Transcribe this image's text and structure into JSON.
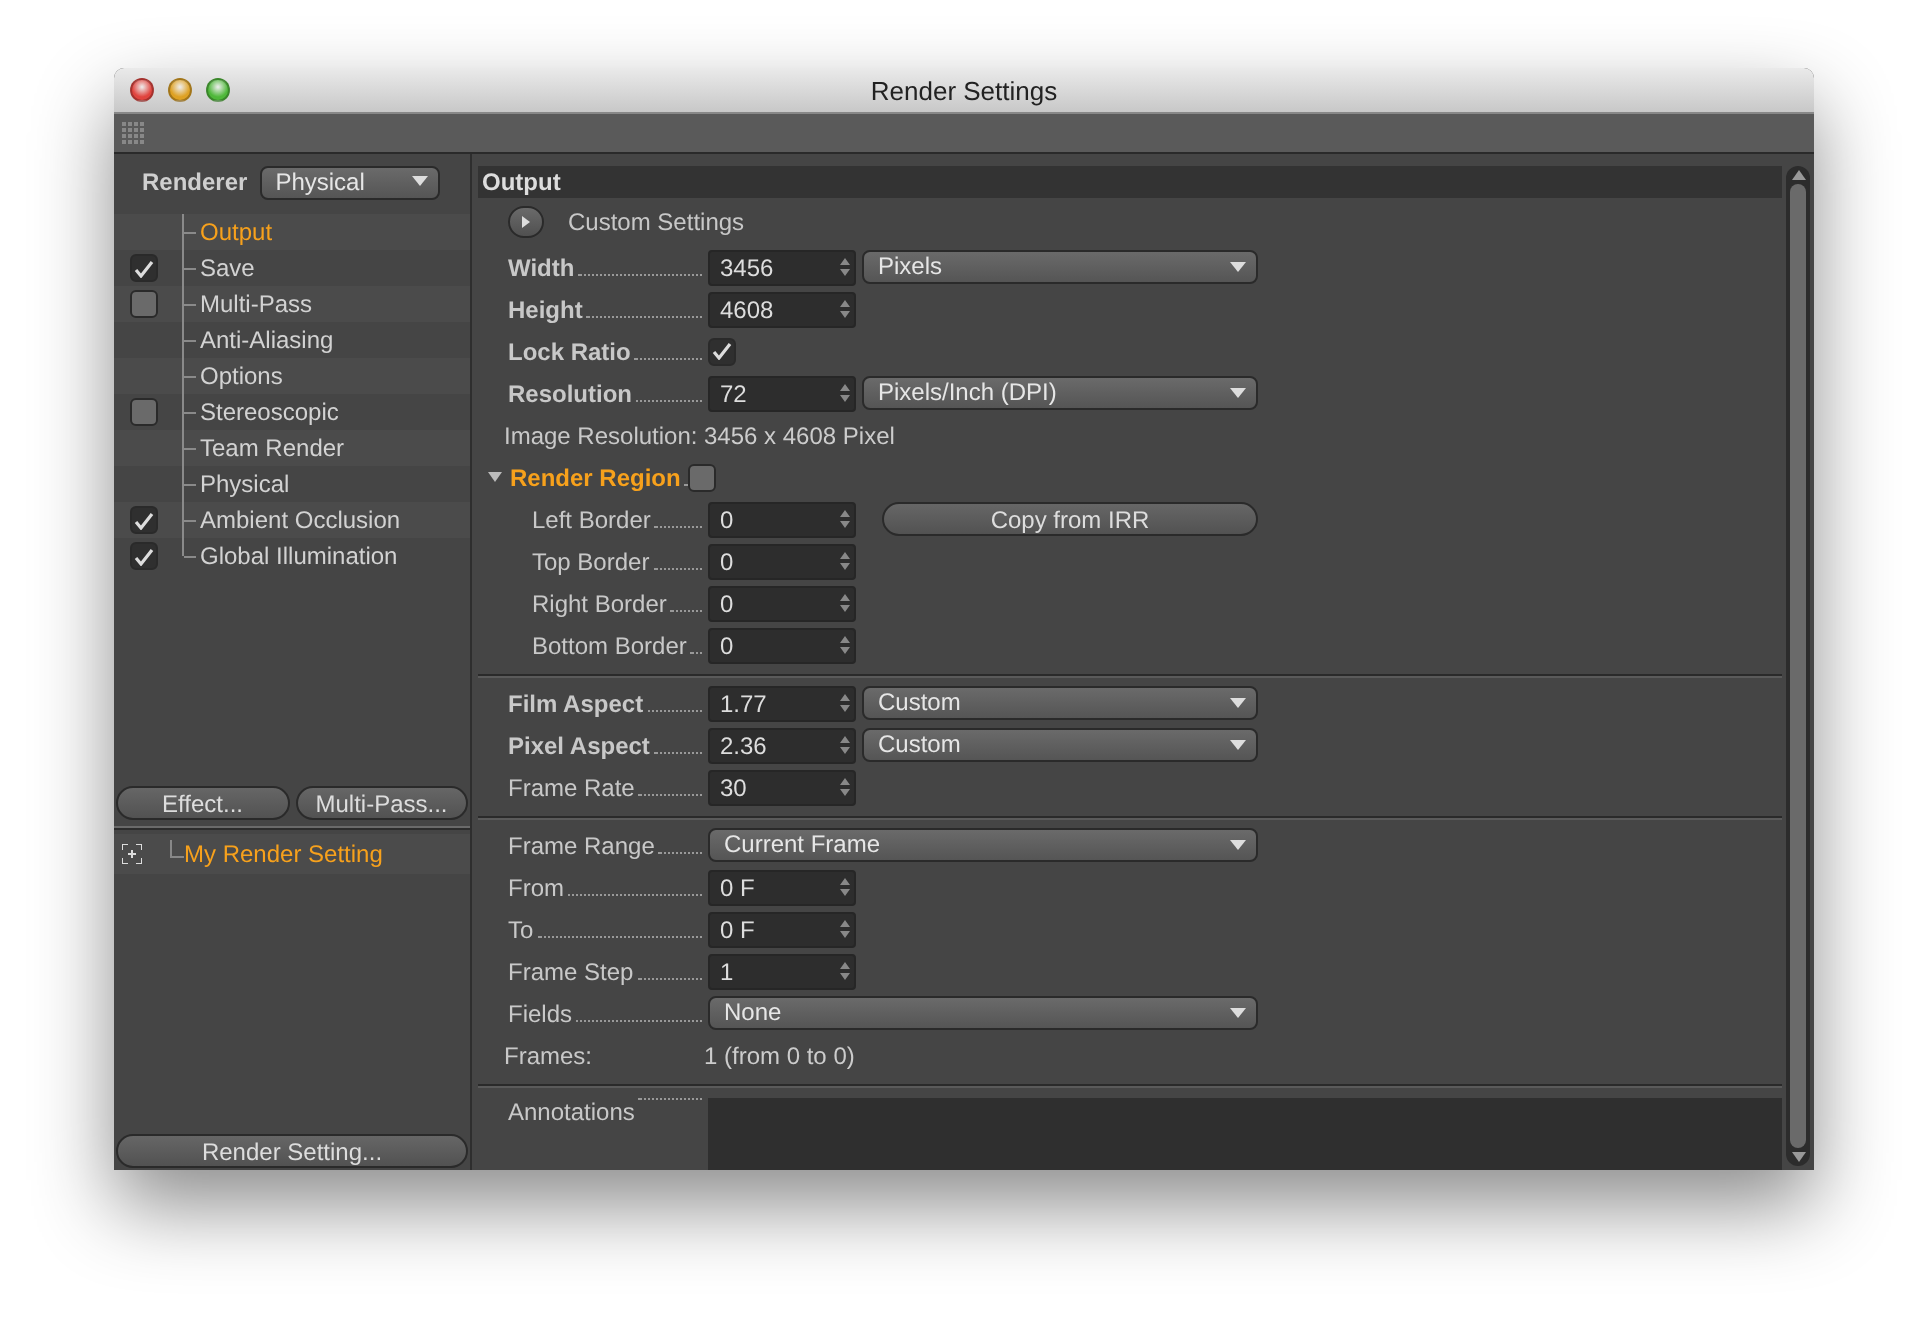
{
  "window": {
    "title": "Render Settings"
  },
  "renderer": {
    "label": "Renderer",
    "value": "Physical"
  },
  "sidebar": {
    "items": [
      {
        "label": "Output",
        "kind": "plain",
        "selected": true
      },
      {
        "label": "Save",
        "kind": "toggle",
        "checked": true,
        "selected": false
      },
      {
        "label": "Multi-Pass",
        "kind": "toggle",
        "checked": false,
        "selected": false
      },
      {
        "label": "Anti-Aliasing",
        "kind": "plain",
        "selected": false
      },
      {
        "label": "Options",
        "kind": "plain",
        "selected": false
      },
      {
        "label": "Stereoscopic",
        "kind": "toggle",
        "checked": false,
        "selected": false
      },
      {
        "label": "Team Render",
        "kind": "plain",
        "selected": false
      },
      {
        "label": "Physical",
        "kind": "plain",
        "selected": false
      },
      {
        "label": "Ambient Occlusion",
        "kind": "toggle",
        "checked": true,
        "selected": false
      },
      {
        "label": "Global Illumination",
        "kind": "toggle",
        "checked": true,
        "selected": false
      }
    ],
    "buttons": [
      "Effect...",
      "Multi-Pass..."
    ],
    "presets": [
      {
        "label": "My Render Setting",
        "selected": true
      }
    ],
    "footer_button": "Render Setting..."
  },
  "panel": {
    "title": "Output",
    "custom_settings": "Custom Settings",
    "sections": [
      {
        "rows": [
          {
            "kind": "field",
            "label": "Width",
            "bold": true,
            "value": "3456",
            "dropdown": "Pixels"
          },
          {
            "kind": "field",
            "label": "Height",
            "bold": true,
            "value": "4608"
          },
          {
            "kind": "check",
            "label": "Lock Ratio",
            "bold": true,
            "checked": true
          },
          {
            "kind": "field",
            "label": "Resolution",
            "bold": true,
            "value": "72",
            "dropdown": "Pixels/Inch (DPI)"
          },
          {
            "kind": "info",
            "label": "Image Resolution:",
            "value": "3456 x 4608 Pixel"
          },
          {
            "kind": "group",
            "label": "Render Region",
            "expanded": true,
            "checked": false,
            "button": "Copy from IRR",
            "children": [
              {
                "kind": "field",
                "label": "Left Border",
                "value": "0"
              },
              {
                "kind": "field",
                "label": "Top Border",
                "value": "0"
              },
              {
                "kind": "field",
                "label": "Right Border",
                "value": "0"
              },
              {
                "kind": "field",
                "label": "Bottom Border",
                "value": "0"
              }
            ]
          }
        ]
      },
      {
        "rows": [
          {
            "kind": "field",
            "label": "Film Aspect",
            "bold": true,
            "value": "1.77",
            "dropdown": "Custom"
          },
          {
            "kind": "field",
            "label": "Pixel Aspect",
            "bold": true,
            "value": "2.36",
            "dropdown": "Custom"
          },
          {
            "kind": "field",
            "label": "Frame Rate",
            "value": "30"
          }
        ]
      },
      {
        "rows": [
          {
            "kind": "select",
            "label": "Frame Range",
            "value": "Current Frame"
          },
          {
            "kind": "field",
            "label": "From",
            "value": "0 F"
          },
          {
            "kind": "field",
            "label": "To",
            "value": "0 F"
          },
          {
            "kind": "field",
            "label": "Frame Step",
            "value": "1"
          },
          {
            "kind": "select",
            "label": "Fields",
            "value": "None"
          },
          {
            "kind": "info",
            "label": "Frames:",
            "value": "1 (from 0 to 0)"
          }
        ]
      },
      {
        "rows": [
          {
            "kind": "text_area",
            "label": "Annotations"
          }
        ]
      }
    ]
  }
}
